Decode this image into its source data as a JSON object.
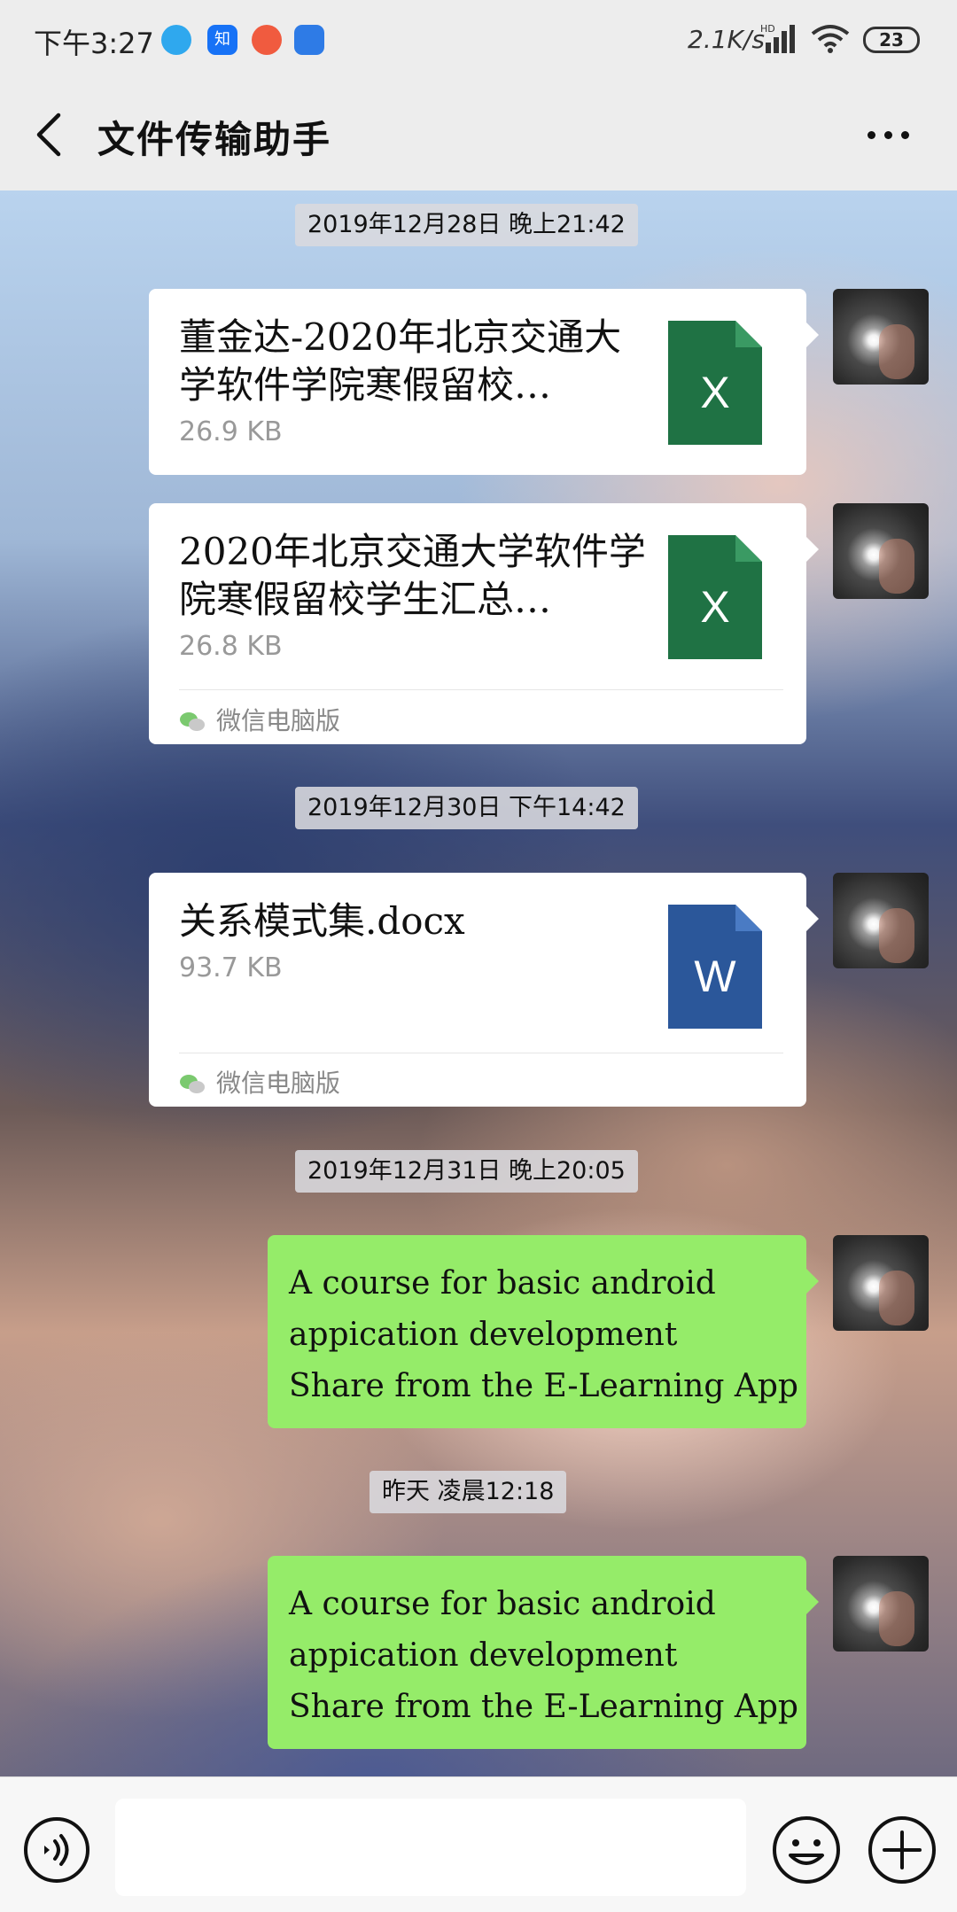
{
  "status_bar": {
    "time": "下午3:27",
    "net_speed": "2.1K/s",
    "network_badge": "HD",
    "battery": "23",
    "apps": [
      "bird-app-icon",
      "zhihu-app-icon",
      "orange-app-icon",
      "blue-app-icon"
    ]
  },
  "header": {
    "title": "文件传输助手",
    "back_icon": "chevron-left-icon",
    "more_icon": "more-dots-icon"
  },
  "timestamps": [
    "2019年12月28日 晚上21:42",
    "2019年12月30日 下午14:42",
    "2019年12月31日 晚上20:05",
    "昨天 凌晨12:18"
  ],
  "messages": [
    {
      "type": "file",
      "name": "董金达-2020年北京交通大学软件学院寒假留校…",
      "size": "26.9 KB",
      "file_type": "excel",
      "icon_letter": "X"
    },
    {
      "type": "file",
      "name": "2020年北京交通大学软件学院寒假留校学生汇总…",
      "size": "26.8 KB",
      "file_type": "excel",
      "icon_letter": "X",
      "source": "微信电脑版"
    },
    {
      "type": "file",
      "name": "关系模式集.docx",
      "size": "93.7 KB",
      "file_type": "word",
      "icon_letter": "W",
      "source": "微信电脑版"
    },
    {
      "type": "text",
      "lines": [
        "A course for basic android",
        "appication development",
        "Share from the E-Learning App"
      ]
    },
    {
      "type": "text",
      "lines": [
        "A course for basic android",
        "appication development",
        "Share from the E-Learning App"
      ]
    }
  ],
  "input_bar": {
    "placeholder": "",
    "voice_icon": "voice-icon",
    "emoji_icon": "emoji-icon",
    "plus_icon": "plus-icon"
  },
  "colors": {
    "excel_green": "#1f7244",
    "word_blue": "#2b579a",
    "bubble_green": "#95ec69",
    "bar_gray": "#ededed"
  }
}
